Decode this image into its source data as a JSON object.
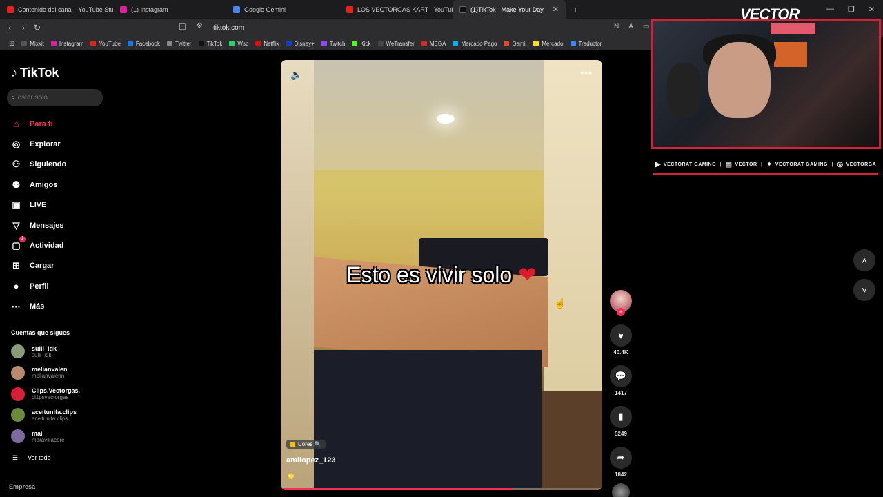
{
  "browser": {
    "tabs": [
      {
        "label": "Contenido del canal - YouTube Studio",
        "color": "#e62117"
      },
      {
        "label": "(1) Instagram",
        "color": "#d6249f"
      },
      {
        "label": "Google Gemini",
        "color": "#4a86e8"
      },
      {
        "label": "LOS VECTORGAS KART - YouTube",
        "color": "#e62117"
      },
      {
        "label": "(1)TikTok - Make Your Day",
        "color": "#111111",
        "active": true
      }
    ],
    "new_tab": "+",
    "url": "tiktok.com",
    "bookmarks": [
      {
        "label": "Mixkit",
        "color": "#555"
      },
      {
        "label": "Instagram",
        "color": "#d6249f"
      },
      {
        "label": "YouTube",
        "color": "#e62117"
      },
      {
        "label": "Facebook",
        "color": "#1877f2"
      },
      {
        "label": "Twitter",
        "color": "#888"
      },
      {
        "label": "TikTok",
        "color": "#111"
      },
      {
        "label": "Wsp",
        "color": "#25d366"
      },
      {
        "label": "Netflix",
        "color": "#e50914"
      },
      {
        "label": "Disney+",
        "color": "#113ccf"
      },
      {
        "label": "Twitch",
        "color": "#9146ff"
      },
      {
        "label": "Kick",
        "color": "#53fc18"
      },
      {
        "label": "WeTransfer",
        "color": "#444"
      },
      {
        "label": "MEGA",
        "color": "#d9272e"
      },
      {
        "label": "Mercado Pago",
        "color": "#00b1ea"
      },
      {
        "label": "Gamil",
        "color": "#ea4335"
      },
      {
        "label": "Mercado",
        "color": "#ffe600"
      },
      {
        "label": "Traductor",
        "color": "#4285f4"
      }
    ]
  },
  "tiktok": {
    "logo": "TikTok",
    "search_placeholder": "estar solo",
    "nav": [
      {
        "label": "Para ti",
        "icon": "home-icon",
        "glyph": "⌂",
        "active": true
      },
      {
        "label": "Explorar",
        "icon": "compass-icon",
        "glyph": "◎"
      },
      {
        "label": "Siguiendo",
        "icon": "user-follow-icon",
        "glyph": "⚇"
      },
      {
        "label": "Amigos",
        "icon": "friends-icon",
        "glyph": "⚉"
      },
      {
        "label": "LIVE",
        "icon": "live-icon",
        "glyph": "▣"
      },
      {
        "label": "Mensajes",
        "icon": "messages-icon",
        "glyph": "▽"
      },
      {
        "label": "Actividad",
        "icon": "activity-icon",
        "glyph": "▢",
        "badge": "1"
      },
      {
        "label": "Cargar",
        "icon": "upload-icon",
        "glyph": "⊞"
      },
      {
        "label": "Perfil",
        "icon": "profile-avatar-icon",
        "glyph": "●"
      },
      {
        "label": "Más",
        "icon": "more-icon",
        "glyph": "···"
      }
    ],
    "following_title": "Cuentas que sigues",
    "following": [
      {
        "name": "sulli_idk",
        "handle": "sulli_idk_",
        "color": "#8a9a7b"
      },
      {
        "name": "melianvalen",
        "handle": "melianvalenn",
        "color": "#b98a6e"
      },
      {
        "name": "Clips.Vectorgas.",
        "handle": "cl1psvectorgas",
        "color": "#d71f3a"
      },
      {
        "name": "aceitunita.clips",
        "handle": "aceitunita.clips",
        "color": "#6b8a3a"
      },
      {
        "name": "mai",
        "handle": "maravillacore",
        "color": "#7a6aa0"
      }
    ],
    "see_all": "Ver todo",
    "company": "Empresa"
  },
  "video": {
    "caption": "Esto es vivir solo",
    "caption_emoji": "❤",
    "tag": "Cores 🔍",
    "author": "amilopez_123",
    "desc_emoji": "😳",
    "progress": 0.72
  },
  "actions": {
    "likes": "40.4K",
    "comments": "1417",
    "saves": "5249",
    "shares": "1842"
  },
  "overlay": {
    "brand": "VECTOR",
    "socials": [
      {
        "icon": "youtube-icon",
        "glyph": "▶",
        "label": "VECTORAT GAMING"
      },
      {
        "icon": "twitch-icon",
        "glyph": "▤",
        "label": "VECTOR"
      },
      {
        "icon": "twitter-icon",
        "glyph": "✦",
        "label": "VECTORAT GAMING"
      },
      {
        "icon": "instagram-icon",
        "glyph": "◎",
        "label": "VECTORGA"
      }
    ]
  }
}
